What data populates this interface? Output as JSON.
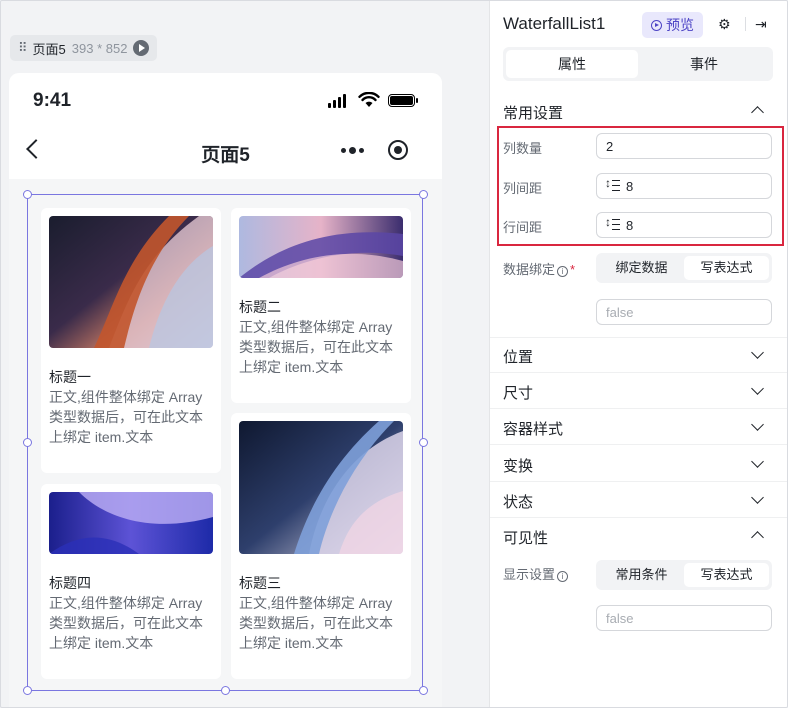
{
  "canvas": {
    "page_name": "页面5",
    "page_size": "393 * 852"
  },
  "phone": {
    "time": "9:41",
    "title": "页面5"
  },
  "cards": [
    {
      "title": "标题一",
      "body": "正文,组件整体绑定 Array 类型数据后，可在此文本上绑定 item.文本"
    },
    {
      "title": "标题二",
      "body": "正文,组件整体绑定 Array 类型数据后，可在此文本上绑定 item.文本"
    },
    {
      "title": "标题四",
      "body": "正文,组件整体绑定 Array 类型数据后，可在此文本上绑定 item.文本"
    },
    {
      "title": "标题三",
      "body": "正文,组件整体绑定 Array 类型数据后，可在此文本上绑定 item.文本"
    }
  ],
  "panel": {
    "component_name": "WaterfallList1",
    "preview_label": "预览",
    "tabs": [
      "属性",
      "事件"
    ],
    "common": {
      "title": "常用设置",
      "columns_label": "列数量",
      "columns_value": "2",
      "col_gap_label": "列间距",
      "col_gap_value": "8",
      "row_gap_label": "行间距",
      "row_gap_value": "8",
      "binding_label": "数据绑定",
      "binding_options": [
        "绑定数据",
        "写表达式"
      ],
      "binding_placeholder": "false"
    },
    "sections": [
      "位置",
      "尺寸",
      "容器样式",
      "变换",
      "状态"
    ],
    "visibility": {
      "title": "可见性",
      "display_label": "显示设置",
      "options": [
        "常用条件",
        "写表达式"
      ],
      "placeholder": "false"
    }
  },
  "colors": {
    "accent": "#4d44c5",
    "selection": "#7a76e0",
    "highlight": "#d9263f"
  }
}
